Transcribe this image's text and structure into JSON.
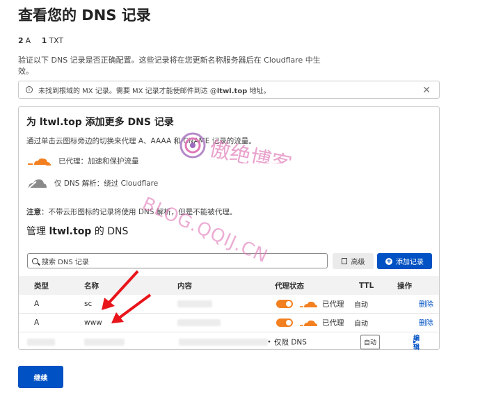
{
  "page": {
    "title": "查看您的 DNS 记录",
    "counts": [
      {
        "num": "2",
        "type": "A"
      },
      {
        "num": "1",
        "type": "TXT"
      }
    ],
    "verify_text": "验证以下 DNS 记录是否正确配置。这些记录将在您更新名称服务器后在 Cloudflare 中生效。",
    "alert_text_pre": "未找到根域的 MX 记录。需要 MX 记录才能使邮件到达 @",
    "alert_domain": "ltwl.top",
    "alert_text_post": " 地址。",
    "continue_label": "继续"
  },
  "card": {
    "heading_pre": "为 ",
    "heading_domain": "ltwl.top",
    "heading_post": " 添加更多 DNS 记录",
    "description": "通过单击云图标旁边的切换来代理 A、AAAA 和 CNAME 记录的流量。",
    "proxied_label": "已代理：加速和保护流量",
    "dns_only_label": "仅 DNS 解析：绕过 Cloudflare",
    "note_label": "注意",
    "note_text": "：不带云形图标的记录将使用 DNS 解析，但是不能被代理。",
    "manage_pre": "管理 ",
    "manage_domain": "ltwl.top",
    "manage_post": " 的 DNS"
  },
  "toolbar": {
    "search_placeholder": "搜索 DNS 记录",
    "advanced_label": "高级",
    "add_record_label": "添加记录"
  },
  "table": {
    "headers": {
      "type": "类型",
      "name": "名称",
      "content": "内容",
      "proxy": "代理状态",
      "ttl": "TTL",
      "actions": "操作"
    },
    "rows": [
      {
        "type": "A",
        "name": "sc",
        "proxy_status": "已代理",
        "ttl": "自动",
        "action": "删除"
      },
      {
        "type": "A",
        "name": "www",
        "proxy_status": "已代理",
        "ttl": "自动",
        "action": "删除"
      },
      {
        "type": "",
        "name": "",
        "proxy_status": "仅限 DNS",
        "ttl": "自动",
        "action": "编辑"
      }
    ]
  },
  "watermark": {
    "line1": "傲绝博客",
    "line2": "BLOG.QQIJ.CN"
  },
  "colors": {
    "accent": "#0051c3",
    "orange": "#f38020",
    "arrow": "#e8151b",
    "watermark": "#e07ab8"
  }
}
